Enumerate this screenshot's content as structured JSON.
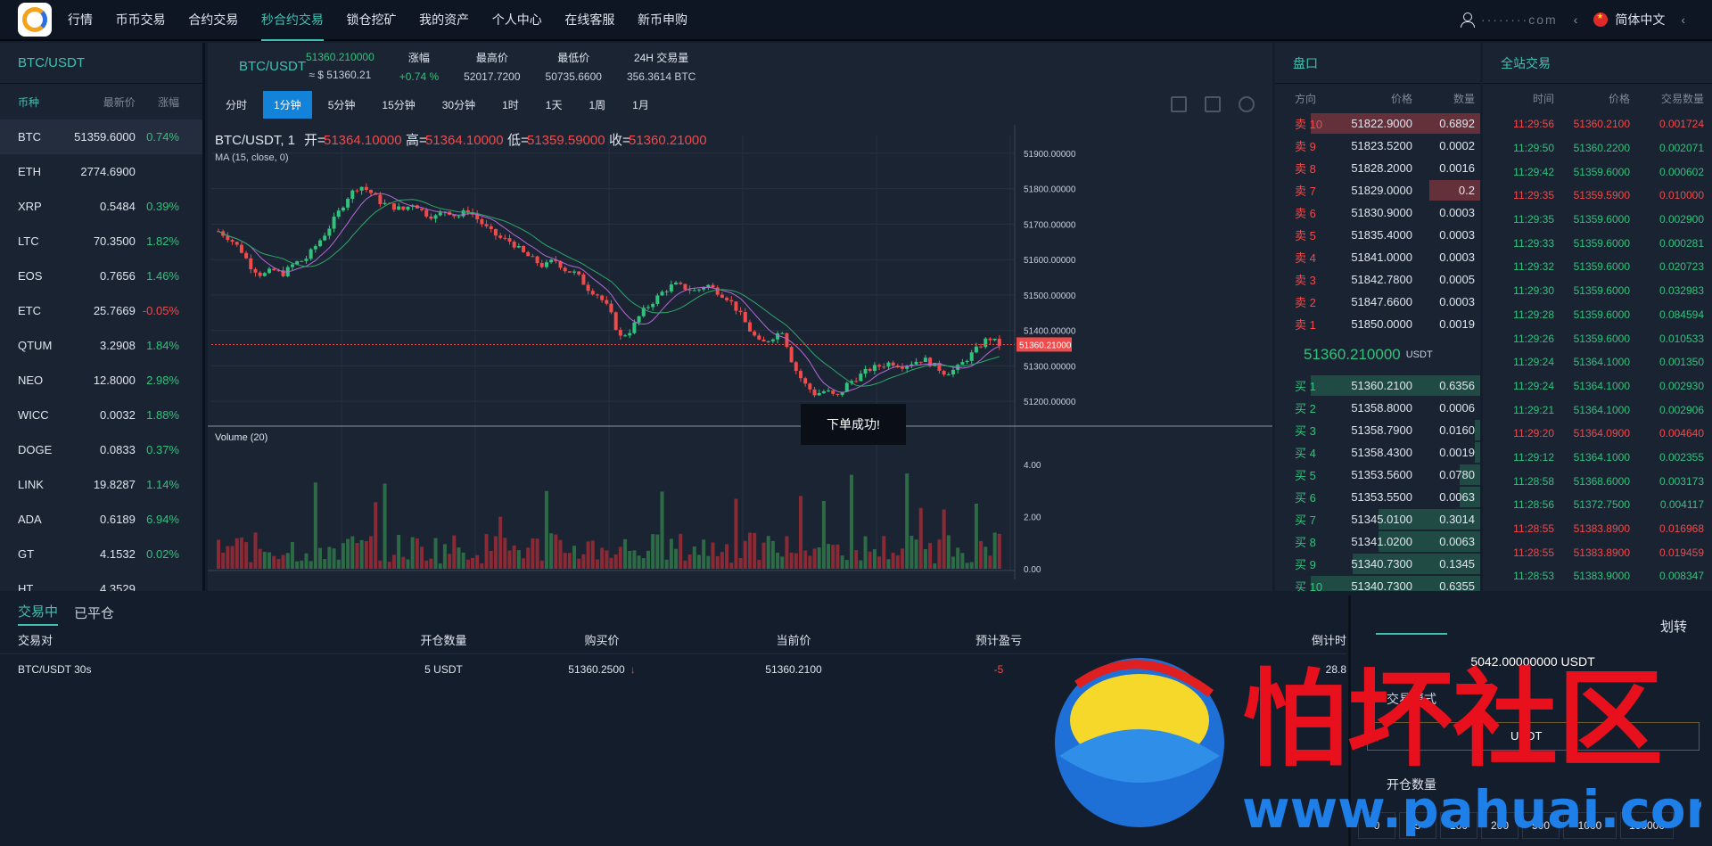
{
  "nav": {
    "items": [
      "行情",
      "币币交易",
      "合约交易",
      "秒合约交易",
      "锁仓挖矿",
      "我的资产",
      "个人中心",
      "在线客服",
      "新币申购"
    ],
    "active_index": 3,
    "account": "········com",
    "language": "简体中文"
  },
  "markets": {
    "pair": "BTC/USDT",
    "col_coin": "币种",
    "col_price": "最新价",
    "col_change": "涨幅",
    "rows": [
      {
        "coin": "BTC",
        "price": "51359.6000",
        "change": "0.74%",
        "dir": "up"
      },
      {
        "coin": "ETH",
        "price": "2774.6900",
        "change": "",
        "dir": "up"
      },
      {
        "coin": "XRP",
        "price": "0.5484",
        "change": "0.39%",
        "dir": "up"
      },
      {
        "coin": "LTC",
        "price": "70.3500",
        "change": "1.82%",
        "dir": "up"
      },
      {
        "coin": "EOS",
        "price": "0.7656",
        "change": "1.46%",
        "dir": "up"
      },
      {
        "coin": "ETC",
        "price": "25.7669",
        "change": "-0.05%",
        "dir": "down"
      },
      {
        "coin": "QTUM",
        "price": "3.2908",
        "change": "1.84%",
        "dir": "up"
      },
      {
        "coin": "NEO",
        "price": "12.8000",
        "change": "2.98%",
        "dir": "up"
      },
      {
        "coin": "WICC",
        "price": "0.0032",
        "change": "1.88%",
        "dir": "up"
      },
      {
        "coin": "DOGE",
        "price": "0.0833",
        "change": "0.37%",
        "dir": "up"
      },
      {
        "coin": "LINK",
        "price": "19.8287",
        "change": "1.14%",
        "dir": "up"
      },
      {
        "coin": "ADA",
        "price": "0.6189",
        "change": "6.94%",
        "dir": "up"
      },
      {
        "coin": "GT",
        "price": "4.1532",
        "change": "0.02%",
        "dir": "up"
      },
      {
        "coin": "HT",
        "price": "4.3529",
        "change": "",
        "dir": "up"
      }
    ]
  },
  "ticker": {
    "pair": "BTC/USDT",
    "last": "51360.210000",
    "last_usd": "≈ $ 51360.21",
    "change_label": "涨幅",
    "change": "+0.74 %",
    "high_label": "最高价",
    "high": "52017.7200",
    "low_label": "最低价",
    "low": "50735.6600",
    "vol_label": "24H 交易量",
    "vol": "356.3614 BTC"
  },
  "intervals": [
    "分时",
    "1分钟",
    "5分钟",
    "15分钟",
    "30分钟",
    "1时",
    "1天",
    "1周",
    "1月"
  ],
  "active_interval": 1,
  "chart_header": {
    "symbol": "BTC/USDT, 1",
    "open_label": "开=",
    "open": "51364.10000",
    "high_label": "高=",
    "high": "51364.10000",
    "low_label": "低=",
    "low": "51359.59000",
    "close_label": "收=",
    "close": "51360.21000",
    "ma_label": "MA (15, close, 0)",
    "volume_label": "Volume (20)",
    "last_tag": "51360.21000"
  },
  "toast": "下单成功!",
  "chart_data": {
    "type": "candlestick",
    "price_axis": [
      "51900.00000",
      "51800.00000",
      "51700.00000",
      "51600.00000",
      "51500.00000",
      "51400.00000",
      "51300.00000",
      "51200.00000"
    ],
    "ylim": [
      51150,
      51950
    ],
    "volume_axis": [
      "4.00",
      "2.00",
      "0.00"
    ],
    "volume_ylim": [
      0,
      5
    ],
    "close_path": [
      51680,
      51660,
      51630,
      51580,
      51555,
      51570,
      51560,
      51590,
      51600,
      51640,
      51680,
      51730,
      51780,
      51810,
      51790,
      51760,
      51750,
      51740,
      51760,
      51730,
      51720,
      51740,
      51720,
      51740,
      51710,
      51680,
      51660,
      51650,
      51620,
      51600,
      51580,
      51600,
      51570,
      51560,
      51520,
      51500,
      51460,
      51380,
      51400,
      51450,
      51480,
      51510,
      51530,
      51520,
      51510,
      51530,
      51510,
      51490,
      51450,
      51400,
      51360,
      51380,
      51400,
      51300,
      51250,
      51220,
      51230,
      51210,
      51250,
      51270,
      51290,
      51300,
      51310,
      51300,
      51310,
      51320,
      51300,
      51280,
      51290,
      51320,
      51350,
      51380,
      51360
    ]
  },
  "orderbook": {
    "title": "盘口",
    "col_side": "方向",
    "col_price": "价格",
    "col_qty": "数量",
    "asks": [
      {
        "side": "卖 10",
        "price": "51822.9000",
        "qty": "0.6892",
        "depth": 1.0
      },
      {
        "side": "卖 9",
        "price": "51823.5200",
        "qty": "0.0002",
        "depth": 0
      },
      {
        "side": "卖 8",
        "price": "51828.2000",
        "qty": "0.0016",
        "depth": 0
      },
      {
        "side": "卖 7",
        "price": "51829.0000",
        "qty": "0.2",
        "depth": 0.3
      },
      {
        "side": "卖 6",
        "price": "51830.9000",
        "qty": "0.0003",
        "depth": 0
      },
      {
        "side": "卖 5",
        "price": "51835.4000",
        "qty": "0.0003",
        "depth": 0
      },
      {
        "side": "卖 4",
        "price": "51841.0000",
        "qty": "0.0003",
        "depth": 0
      },
      {
        "side": "卖 3",
        "price": "51842.7800",
        "qty": "0.0005",
        "depth": 0
      },
      {
        "side": "卖 2",
        "price": "51847.6600",
        "qty": "0.0003",
        "depth": 0
      },
      {
        "side": "卖 1",
        "price": "51850.0000",
        "qty": "0.0019",
        "depth": 0
      }
    ],
    "last": "51360.210000",
    "last_unit": "USDT",
    "bids": [
      {
        "side": "买 1",
        "price": "51360.2100",
        "qty": "0.6356",
        "depth": 1.0
      },
      {
        "side": "买 2",
        "price": "51358.8000",
        "qty": "0.0006",
        "depth": 0
      },
      {
        "side": "买 3",
        "price": "51358.7900",
        "qty": "0.0160",
        "depth": 0.03
      },
      {
        "side": "买 4",
        "price": "51358.4300",
        "qty": "0.0019",
        "depth": 0.03
      },
      {
        "side": "买 5",
        "price": "51353.5600",
        "qty": "0.0780",
        "depth": 0.12
      },
      {
        "side": "买 6",
        "price": "51353.5500",
        "qty": "0.0063",
        "depth": 0.12
      },
      {
        "side": "买 7",
        "price": "51345.0100",
        "qty": "0.3014",
        "depth": 0.6
      },
      {
        "side": "买 8",
        "price": "51341.0200",
        "qty": "0.0063",
        "depth": 0.6
      },
      {
        "side": "买 9",
        "price": "51340.7300",
        "qty": "0.1345",
        "depth": 0.75
      },
      {
        "side": "买 10",
        "price": "51340.7300",
        "qty": "0.6355",
        "depth": 1.0
      }
    ]
  },
  "trades": {
    "title": "全站交易",
    "col_time": "时间",
    "col_price": "价格",
    "col_qty": "交易数量",
    "rows": [
      {
        "time": "11:29:56",
        "price": "51360.2100",
        "qty": "0.001724",
        "dir": "down"
      },
      {
        "time": "11:29:50",
        "price": "51360.2200",
        "qty": "0.002071",
        "dir": "up"
      },
      {
        "time": "11:29:42",
        "price": "51359.6000",
        "qty": "0.000602",
        "dir": "up"
      },
      {
        "time": "11:29:35",
        "price": "51359.5900",
        "qty": "0.010000",
        "dir": "down"
      },
      {
        "time": "11:29:35",
        "price": "51359.6000",
        "qty": "0.002900",
        "dir": "up"
      },
      {
        "time": "11:29:33",
        "price": "51359.6000",
        "qty": "0.000281",
        "dir": "up"
      },
      {
        "time": "11:29:32",
        "price": "51359.6000",
        "qty": "0.020723",
        "dir": "up"
      },
      {
        "time": "11:29:30",
        "price": "51359.6000",
        "qty": "0.032983",
        "dir": "up"
      },
      {
        "time": "11:29:28",
        "price": "51359.6000",
        "qty": "0.084594",
        "dir": "up"
      },
      {
        "time": "11:29:26",
        "price": "51359.6000",
        "qty": "0.010533",
        "dir": "up"
      },
      {
        "time": "11:29:24",
        "price": "51364.1000",
        "qty": "0.001350",
        "dir": "up"
      },
      {
        "time": "11:29:24",
        "price": "51364.1000",
        "qty": "0.002930",
        "dir": "up"
      },
      {
        "time": "11:29:21",
        "price": "51364.1000",
        "qty": "0.002906",
        "dir": "up"
      },
      {
        "time": "11:29:20",
        "price": "51364.0900",
        "qty": "0.004640",
        "dir": "down"
      },
      {
        "time": "11:29:12",
        "price": "51364.1000",
        "qty": "0.002355",
        "dir": "up"
      },
      {
        "time": "11:28:58",
        "price": "51368.6000",
        "qty": "0.003173",
        "dir": "up"
      },
      {
        "time": "11:28:56",
        "price": "51372.7500",
        "qty": "0.004117",
        "dir": "up"
      },
      {
        "time": "11:28:55",
        "price": "51383.8900",
        "qty": "0.016968",
        "dir": "down"
      },
      {
        "time": "11:28:55",
        "price": "51383.8900",
        "qty": "0.019459",
        "dir": "down"
      },
      {
        "time": "11:28:53",
        "price": "51383.9000",
        "qty": "0.008347",
        "dir": "up"
      }
    ]
  },
  "positions": {
    "tab_open": "交易中",
    "tab_closed": "已平仓",
    "headers": [
      "交易对",
      "开仓数量",
      "购买价",
      "当前价",
      "预计盈亏",
      "倒计时"
    ],
    "rows": [
      {
        "pair": "BTC/USDT 30s",
        "qty": "5 USDT",
        "buy": "51360.2500",
        "current": "51360.2100",
        "pnl": "-5",
        "countdown": "28.8"
      }
    ]
  },
  "transfer": {
    "title": "划转",
    "balance": "5042.00000000 USDT",
    "mode_label": "交易模式",
    "unit": "USDT",
    "qty_label": "开仓数量",
    "amounts": [
      "0",
      "5",
      "100",
      "200",
      "500",
      "1000",
      "100000"
    ]
  },
  "watermark": {
    "text": "怕坏社区",
    "url": "www.pahuai.com"
  },
  "colors": {
    "accent": "#3ec1b0",
    "up": "#31c27c",
    "down": "#f04a4a",
    "bg": "#141d2b",
    "panel": "#1a2332"
  }
}
